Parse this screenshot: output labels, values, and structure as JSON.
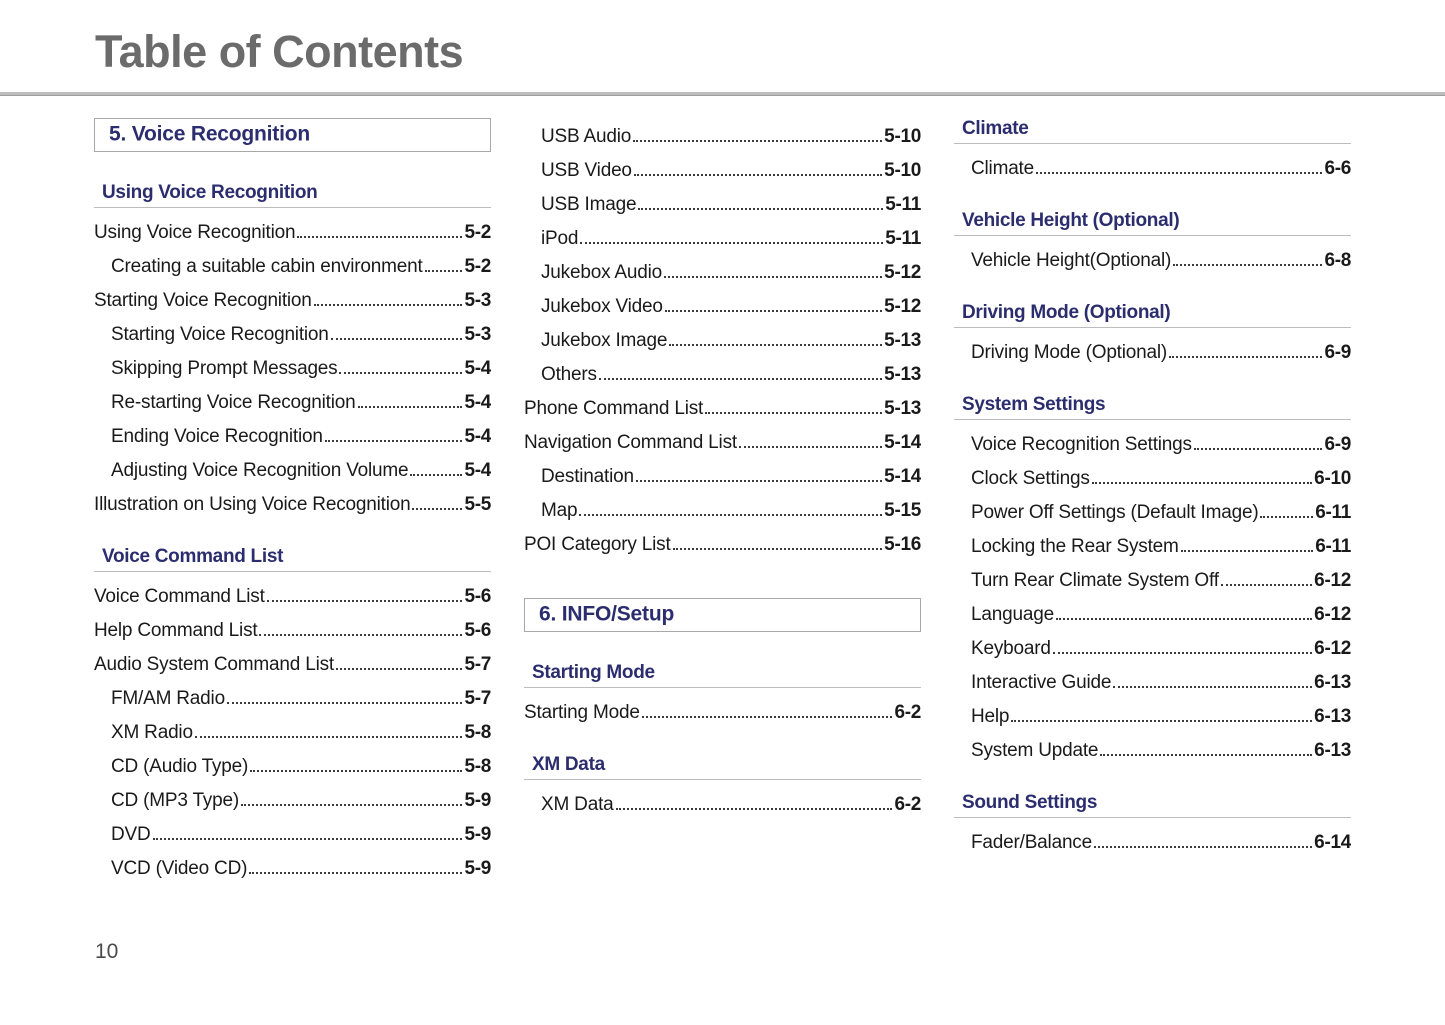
{
  "header": {
    "title": "Table of Contents"
  },
  "footer": {
    "page_number": "10"
  },
  "colors": {
    "heading_blue": "#2b2d6e",
    "title_gray": "#6b6b6b",
    "rule_gray": "#bdbdbd"
  },
  "columns": [
    {
      "blocks": [
        {
          "type": "chapter",
          "label": "5. Voice Recognition"
        },
        {
          "type": "section",
          "heading": "Using Voice Recognition"
        },
        {
          "type": "entry",
          "level": 1,
          "label": "Using Voice Recognition",
          "page": "5-2"
        },
        {
          "type": "entry",
          "level": 2,
          "label": "Creating a suitable cabin environment",
          "page": "5-2"
        },
        {
          "type": "entry",
          "level": 1,
          "label": "Starting Voice Recognition",
          "page": "5-3"
        },
        {
          "type": "entry",
          "level": 2,
          "label": "Starting Voice Recognition",
          "page": "5-3"
        },
        {
          "type": "entry",
          "level": 2,
          "label": "Skipping Prompt Messages",
          "page": "5-4"
        },
        {
          "type": "entry",
          "level": 2,
          "label": "Re-starting Voice Recognition",
          "page": "5-4"
        },
        {
          "type": "entry",
          "level": 2,
          "label": "Ending Voice Recognition",
          "page": "5-4"
        },
        {
          "type": "entry",
          "level": 2,
          "label": "Adjusting Voice Recognition Volume",
          "page": "5-4"
        },
        {
          "type": "entry",
          "level": 1,
          "label": "Illustration on Using Voice Recognition",
          "page": "5-5"
        },
        {
          "type": "section",
          "heading": "Voice Command List"
        },
        {
          "type": "entry",
          "level": 1,
          "label": "Voice Command List",
          "page": "5-6"
        },
        {
          "type": "entry",
          "level": 1,
          "label": "Help Command List",
          "page": "5-6"
        },
        {
          "type": "entry",
          "level": 1,
          "label": "Audio System Command List",
          "page": "5-7"
        },
        {
          "type": "entry",
          "level": 2,
          "label": "FM/AM Radio",
          "page": "5-7"
        },
        {
          "type": "entry",
          "level": 2,
          "label": "XM Radio",
          "page": "5-8"
        },
        {
          "type": "entry",
          "level": 2,
          "label": "CD (Audio Type)",
          "page": "5-8"
        },
        {
          "type": "entry",
          "level": 2,
          "label": "CD (MP3 Type)",
          "page": "5-9"
        },
        {
          "type": "entry",
          "level": 2,
          "label": "DVD",
          "page": "5-9"
        },
        {
          "type": "entry",
          "level": 2,
          "label": "VCD (Video CD)",
          "page": "5-9"
        }
      ]
    },
    {
      "blocks": [
        {
          "type": "entry",
          "level": 2,
          "label": "USB Audio",
          "page": "5-10"
        },
        {
          "type": "entry",
          "level": 2,
          "label": "USB Video",
          "page": "5-10"
        },
        {
          "type": "entry",
          "level": 2,
          "label": "USB Image",
          "page": "5-11"
        },
        {
          "type": "entry",
          "level": 2,
          "label": "iPod",
          "page": "5-11"
        },
        {
          "type": "entry",
          "level": 2,
          "label": "Jukebox Audio",
          "page": "5-12"
        },
        {
          "type": "entry",
          "level": 2,
          "label": "Jukebox Video",
          "page": "5-12"
        },
        {
          "type": "entry",
          "level": 2,
          "label": "Jukebox Image",
          "page": "5-13"
        },
        {
          "type": "entry",
          "level": 2,
          "label": "Others",
          "page": "5-13"
        },
        {
          "type": "entry",
          "level": 1,
          "label": "Phone Command List",
          "page": "5-13"
        },
        {
          "type": "entry",
          "level": 1,
          "label": "Navigation Command List",
          "page": "5-14"
        },
        {
          "type": "entry",
          "level": 2,
          "label": "Destination",
          "page": "5-14"
        },
        {
          "type": "entry",
          "level": 2,
          "label": "Map",
          "page": "5-15"
        },
        {
          "type": "entry",
          "level": 1,
          "label": "POI Category List",
          "page": "5-16"
        },
        {
          "type": "chapter",
          "label": "6. INFO/Setup"
        },
        {
          "type": "section",
          "heading": "Starting Mode"
        },
        {
          "type": "entry",
          "level": 1,
          "label": "Starting Mode",
          "page": "6-2"
        },
        {
          "type": "section",
          "heading": "XM Data"
        },
        {
          "type": "entry",
          "level": 2,
          "label": "XM Data",
          "page": "6-2"
        }
      ]
    },
    {
      "blocks": [
        {
          "type": "section",
          "heading": "Climate"
        },
        {
          "type": "entry",
          "level": 2,
          "label": "Climate",
          "page": "6-6"
        },
        {
          "type": "section",
          "heading": "Vehicle Height (Optional)"
        },
        {
          "type": "entry",
          "level": 2,
          "label": "Vehicle Height(Optional)",
          "page": "6-8"
        },
        {
          "type": "section",
          "heading": "Driving Mode (Optional)"
        },
        {
          "type": "entry",
          "level": 2,
          "label": "Driving Mode (Optional)",
          "page": "6-9"
        },
        {
          "type": "section",
          "heading": "System Settings"
        },
        {
          "type": "entry",
          "level": 2,
          "label": "Voice Recognition Settings",
          "page": "6-9"
        },
        {
          "type": "entry",
          "level": 2,
          "label": "Clock Settings",
          "page": "6-10"
        },
        {
          "type": "entry",
          "level": 2,
          "label": "Power Off Settings (Default Image)",
          "page": "6-11"
        },
        {
          "type": "entry",
          "level": 2,
          "label": "Locking the Rear System",
          "page": "6-11"
        },
        {
          "type": "entry",
          "level": 2,
          "label": "Turn Rear Climate System Off",
          "page": "6-12"
        },
        {
          "type": "entry",
          "level": 2,
          "label": "Language",
          "page": "6-12"
        },
        {
          "type": "entry",
          "level": 2,
          "label": "Keyboard",
          "page": "6-12"
        },
        {
          "type": "entry",
          "level": 2,
          "label": "Interactive Guide",
          "page": "6-13"
        },
        {
          "type": "entry",
          "level": 2,
          "label": "Help",
          "page": "6-13"
        },
        {
          "type": "entry",
          "level": 2,
          "label": "System Update",
          "page": "6-13"
        },
        {
          "type": "section",
          "heading": "Sound Settings"
        },
        {
          "type": "entry",
          "level": 2,
          "label": "Fader/Balance",
          "page": "6-14"
        }
      ]
    }
  ]
}
